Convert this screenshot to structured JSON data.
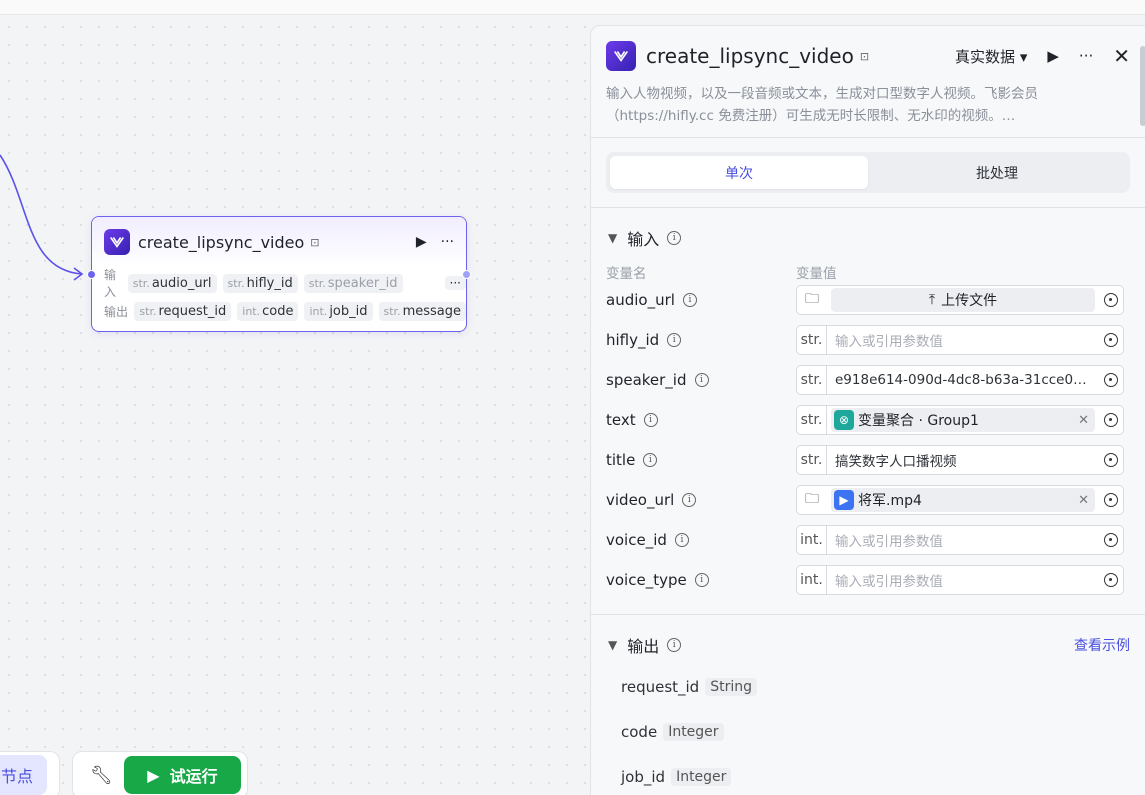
{
  "node": {
    "title": "create_lipsync_video",
    "input_label": "输入",
    "output_label": "输出",
    "inputs": [
      {
        "type": "str.",
        "name": "audio_url"
      },
      {
        "type": "str.",
        "name": "hifly_id"
      },
      {
        "type": "str.",
        "name": "speaker_id"
      }
    ],
    "outputs": [
      {
        "type": "str.",
        "name": "request_id"
      },
      {
        "type": "int.",
        "name": "code"
      },
      {
        "type": "int.",
        "name": "job_id"
      },
      {
        "type": "str.",
        "name": "message"
      }
    ],
    "more": "···"
  },
  "toolbar": {
    "nodes_label": "节点",
    "run_label": "试运行"
  },
  "panel": {
    "title": "create_lipsync_video",
    "data_select": "真实数据",
    "description": "输入人物视频，以及一段音频或文本，生成对口型数字人视频。飞影会员（https://hifly.cc 免费注册）可生成无时长限制、无水印的视频。…",
    "tabs": [
      "单次",
      "批处理"
    ],
    "input_section": "输入",
    "col_name": "变量名",
    "col_value": "变量值",
    "params": {
      "audio_url": {
        "name": "audio_url",
        "upload": "上传文件"
      },
      "hifly_id": {
        "name": "hifly_id",
        "type": "str.",
        "placeholder": "输入或引用参数值"
      },
      "speaker_id": {
        "name": "speaker_id",
        "type": "str.",
        "value": "e918e614-090d-4dc8-b63a-31cce0…"
      },
      "text": {
        "name": "text",
        "type": "str.",
        "ref": "变量聚合 · Group1"
      },
      "title": {
        "name": "title",
        "type": "str.",
        "value": "搞笑数字人口播视频"
      },
      "video_url": {
        "name": "video_url",
        "file": "将军.mp4"
      },
      "voice_id": {
        "name": "voice_id",
        "type": "int.",
        "placeholder": "输入或引用参数值"
      },
      "voice_type": {
        "name": "voice_type",
        "type": "int.",
        "placeholder": "输入或引用参数值"
      }
    },
    "output_section": "输出",
    "example_link": "查看示例",
    "outputs": [
      {
        "name": "request_id",
        "type": "String"
      },
      {
        "name": "code",
        "type": "Integer"
      },
      {
        "name": "job_id",
        "type": "Integer"
      }
    ]
  },
  "colors": {
    "accent": "#4a4fe0",
    "run": "#18a847",
    "node_border": "#6b62f0"
  }
}
